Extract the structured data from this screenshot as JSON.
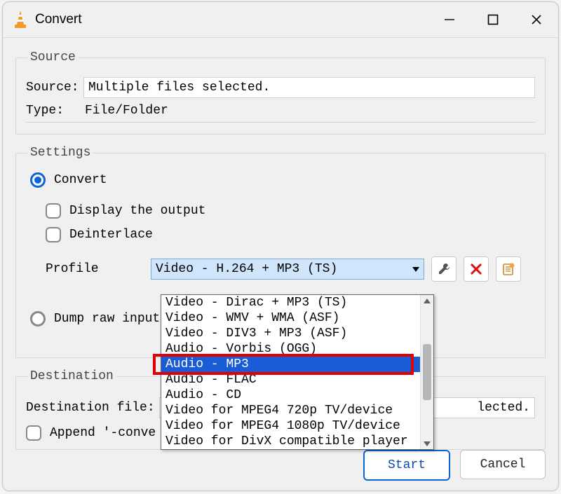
{
  "window": {
    "title": "Convert"
  },
  "source": {
    "legend": "Source",
    "source_label": "Source:",
    "source_value": "Multiple files selected.",
    "type_label": "Type:",
    "type_value": "File/Folder"
  },
  "settings": {
    "legend": "Settings",
    "convert_label": "Convert",
    "display_output_label": "Display the output",
    "deinterlace_label": "Deinterlace",
    "profile_label": "Profile",
    "profile_selected": "Video - H.264 + MP3 (TS)",
    "profile_options": [
      "Video - Dirac + MP3 (TS)",
      "Video - WMV + WMA (ASF)",
      "Video - DIV3 + MP3 (ASF)",
      "Audio - Vorbis (OGG)",
      "Audio - MP3",
      "Audio - FLAC",
      "Audio - CD",
      "Video for MPEG4 720p TV/device",
      "Video for MPEG4 1080p TV/device",
      "Video for DivX compatible player"
    ],
    "profile_highlight_index": 4,
    "dump_raw_label": "Dump raw input"
  },
  "destination": {
    "legend": "Destination",
    "file_label": "Destination file:",
    "file_value_tail": "lected.",
    "append_label": "Append '-conve"
  },
  "footer": {
    "start_label": "Start",
    "cancel_label": "Cancel"
  }
}
